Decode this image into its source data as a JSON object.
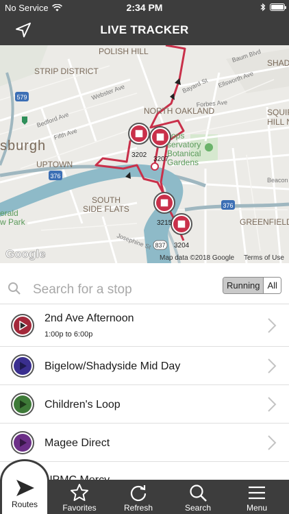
{
  "status_bar": {
    "carrier": "No Service",
    "time": "2:34 PM"
  },
  "header": {
    "title": "LIVE TRACKER"
  },
  "map": {
    "labels": {
      "polish_hill": "POLISH HILL",
      "strip_district": "STRIP DISTRICT",
      "north_oakland": "NORTH OAKLAND",
      "burgh": "sburgh",
      "uptown": "UPTOWN",
      "south_side_flats": "SOUTH\nSIDE FLATS",
      "greenfield": "GREENFIELD",
      "squirrel_hill": "SQUIR\nHILL N",
      "shady": "SHADY",
      "conservatory": "ops\nservatory\nBotanical\nGardens",
      "baum_blvd": "Baum Blvd",
      "bayard": "Bayard St",
      "ellsworth": "Ellsworth Ave",
      "forbes": "Forbes Ave",
      "webster": "Webster Ave",
      "bedford": "Bedford Ave",
      "fifth": "Fifth Ave",
      "beacon": "Beacon",
      "josephine": "Josephine St",
      "river_park": "erald\nw Park",
      "hwy_579": "579",
      "hwy_376_left": "376",
      "hwy_376_right": "376",
      "hwy_837": "837"
    },
    "stops": [
      "3202",
      "3207",
      "3215",
      "3204"
    ],
    "google_logo": "Google",
    "attribution": "Map data ©2018 Google",
    "terms": "Terms of Use"
  },
  "search": {
    "placeholder": "Search for a stop"
  },
  "filter": {
    "running": "Running",
    "all": "All"
  },
  "routes": [
    {
      "name": "2nd Ave Afternoon",
      "time": "1:00p to 6:00p",
      "color": "#a3283a"
    },
    {
      "name": "Bigelow/Shadyside Mid Day",
      "time": "",
      "color": "#3a2f8f"
    },
    {
      "name": "Children's Loop",
      "time": "",
      "color": "#3e7a38"
    },
    {
      "name": "Magee Direct",
      "time": "",
      "color": "#6c2f87"
    },
    {
      "name": "UPMC Mercy",
      "time": "",
      "color": "#777777"
    }
  ],
  "tabs": {
    "routes": "Routes",
    "favorites": "Favorites",
    "refresh": "Refresh",
    "search": "Search",
    "menu": "Menu"
  },
  "colors": {
    "bar": "#3d3d3d",
    "route_line": "#c9304a",
    "river": "#8ebac8"
  }
}
